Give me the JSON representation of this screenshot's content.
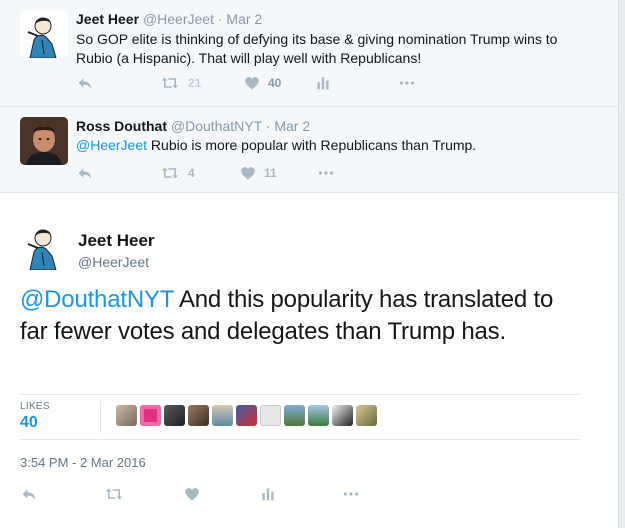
{
  "colors": {
    "accent": "#1b95e0",
    "muted": "#aab8c2",
    "text": "#14171a",
    "secondary": "#657786",
    "reply_bg": "#f5f8fa"
  },
  "tweet1": {
    "name": "Jeet Heer",
    "handle": "@HeerJeet",
    "date": "· Mar 2",
    "text": "So GOP elite is thinking of defying its base & giving nomination Trump wins to Rubio (a Hispanic). That will play well with Republicans!",
    "retweets": "21",
    "likes": "40"
  },
  "tweet2": {
    "name": "Ross Douthat",
    "handle": "@DouthatNYT",
    "date": "· Mar 2",
    "mention": "@HeerJeet",
    "text": " Rubio is more popular with Republicans than Trump.",
    "retweets": "4",
    "likes": "11"
  },
  "main": {
    "name": "Jeet Heer",
    "handle": "@HeerJeet",
    "mention": "@DouthatNYT",
    "text": " And this popularity has translated to far fewer votes and delegates than Trump has.",
    "likes_label": "LIKES",
    "likes_count": "40",
    "timestamp": "3:54 PM - 2 Mar 2016"
  },
  "icons": [
    "reply-icon",
    "retweet-icon",
    "like-icon",
    "analytics-icon",
    "more-icon"
  ]
}
